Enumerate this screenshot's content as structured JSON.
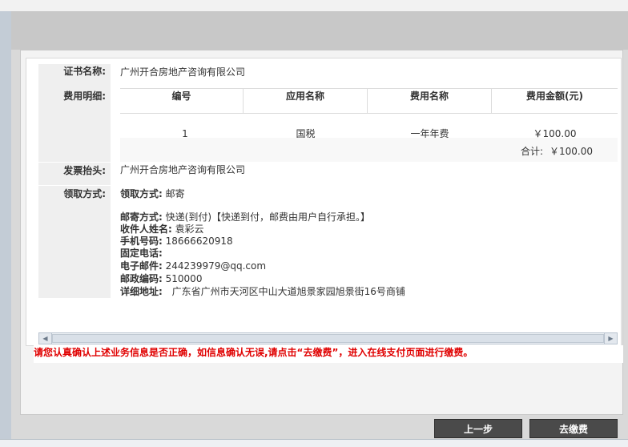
{
  "labels": {
    "cert_name": "证书名称:",
    "fee_detail": "费用明细:",
    "invoice_title": "发票抬头:",
    "receive_method": "领取方式:"
  },
  "cert_name_value": "广州开合房地产咨询有限公司",
  "fee_table": {
    "headers": [
      "编号",
      "应用名称",
      "费用名称",
      "费用金额(元)"
    ],
    "rows": [
      {
        "no": "1",
        "app": "国税",
        "fee_name": "一年年费",
        "amount": "￥100.00"
      }
    ],
    "total_label": "合计:",
    "total_value": "￥100.00"
  },
  "invoice_title_value": "广州开合房地产咨询有限公司",
  "receive": {
    "method_label": "领取方式:",
    "method_value": "邮寄",
    "mail_label": "邮寄方式:",
    "mail_value": "快递(到付)【快递到付，邮费由用户自行承担。】",
    "name_label": "收件人姓名:",
    "name_value": "袁彩云",
    "mobile_label": "手机号码:",
    "mobile_value": "18666620918",
    "phone_label": "固定电话:",
    "phone_value": "",
    "email_label": "电子邮件:",
    "email_value": "244239979@qq.com",
    "postcode_label": "邮政编码:",
    "postcode_value": "510000",
    "address_label": "详细地址:",
    "address_value": "广东省广州市天河区中山大道旭景家园旭景街16号商铺"
  },
  "notice": "请您认真确认上述业务信息是否正确，如信息确认无误,请点击“去缴费”，进入在线支付页面进行缴费。",
  "buttons": {
    "prev": "上一步",
    "pay": "去缴费"
  },
  "colors": {
    "notice": "#e00000",
    "button_bg": "#4a4a4a",
    "label_bg": "#efefef"
  }
}
